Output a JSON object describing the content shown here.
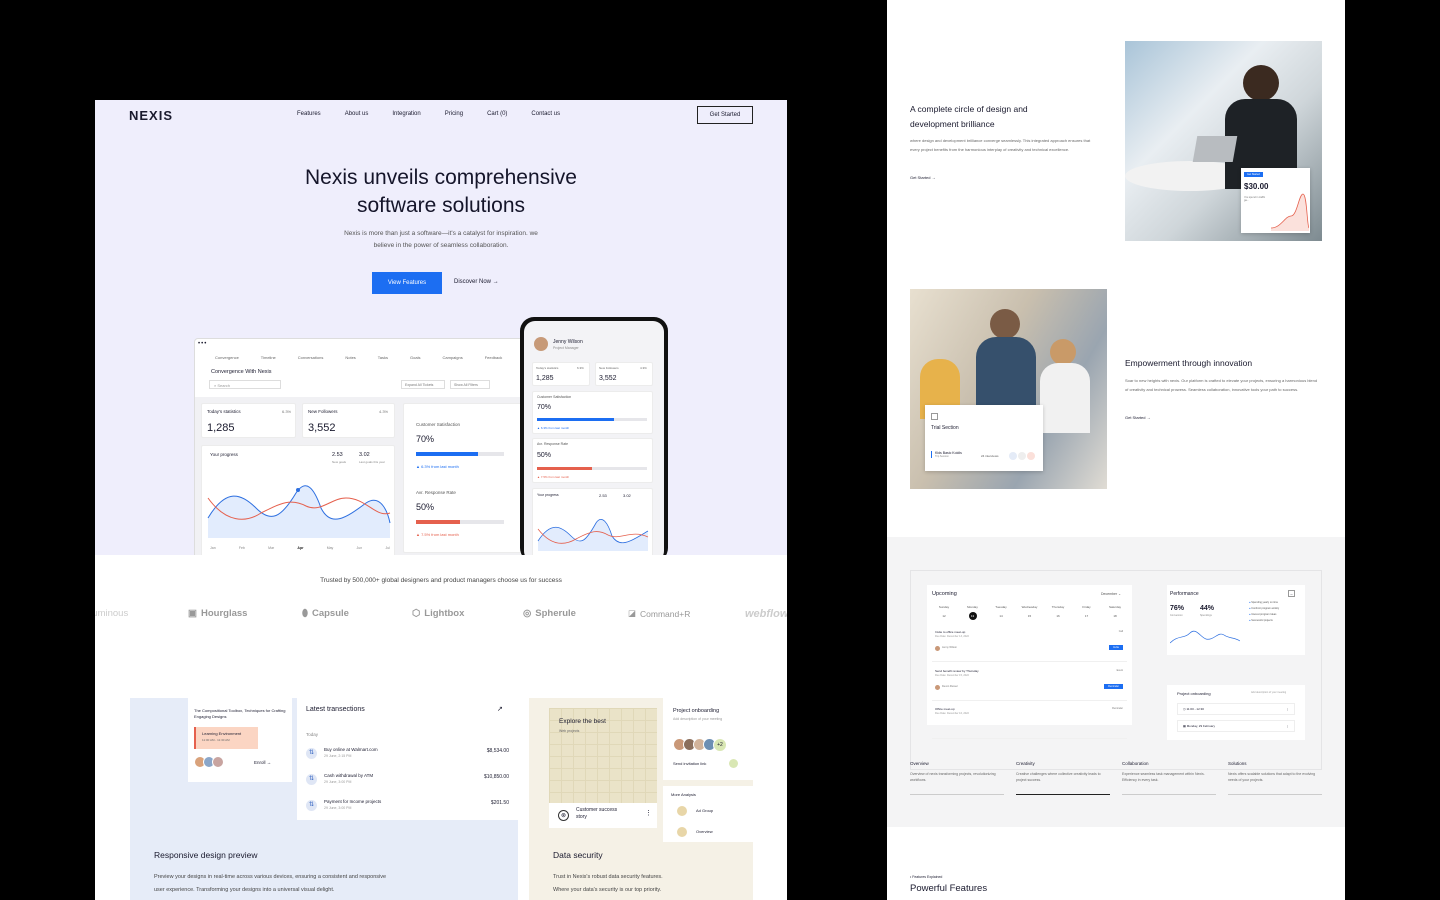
{
  "nav": {
    "logo": "NEXIS",
    "links": [
      "Features",
      "About us",
      "Integration",
      "Pricing",
      "Cart (0)",
      "Contact us"
    ],
    "cta": "Get Started"
  },
  "hero": {
    "title_line1": "Nexis unveils comprehensive",
    "title_line2": "software solutions",
    "subtitle_line1": "Nexis is more than just a software—it's a catalyst for inspiration. we",
    "subtitle_line2": "believe in the power of seamless collaboration.",
    "primary_btn": "View Features",
    "secondary_btn": "Discover Now"
  },
  "dashboard": {
    "tabs": [
      "Convergence",
      "Timeline",
      "Conversations",
      "Notes",
      "Tasks",
      "Goals",
      "Campaigns",
      "Feedback"
    ],
    "title": "Convergence With Nexis",
    "search_placeholder": "Search",
    "expand_btn": "Expand All Tickets",
    "show_btn": "Show All Filters",
    "stats": [
      {
        "label": "Today's statistics",
        "change": "6.3%",
        "value": "1,285"
      },
      {
        "label": "New Followers",
        "change": "4.3%",
        "value": "3,552"
      }
    ],
    "progress": {
      "label": "Your progress",
      "v1": "2.53",
      "v1_label": "New goals",
      "v2": "3.02",
      "v2_label": "Last goals this year"
    },
    "months": [
      "Jan",
      "Feb",
      "Mar",
      "Apr",
      "May",
      "Jun",
      "Jul"
    ],
    "satisfaction": {
      "label": "Customer Satisfaction",
      "value": "70%",
      "note": "6.3% from last month",
      "fill": 0.7
    },
    "response": {
      "label": "Avr. Response Rate",
      "value": "50%",
      "note": "7.5% from last month",
      "fill": 0.5
    }
  },
  "phone": {
    "name": "Jenny Wilson",
    "role": "Project Manager",
    "stat1_label": "Today's statistics",
    "stat1_change": "6.3%",
    "stat1": "1,285",
    "stat2_label": "New Followers",
    "stat2_change": "4.3%",
    "stat2": "3,552",
    "sat_label": "Customer Satisfaction",
    "sat": "70%",
    "sat_note": "6.3% from last month",
    "resp_label": "Avr. Response Rate",
    "resp": "50%",
    "resp_note": "7.5% from last month",
    "prog_label": "Your progress",
    "prog_v1": "2.53",
    "prog_v2": "3.02"
  },
  "trusted": "Trusted by 500,000+ global designers and product managers choose us for success",
  "brands": [
    "Luminous",
    "Hourglass",
    "Capsule",
    "Lightbox",
    "Spherule",
    "Command+R",
    "webflow"
  ],
  "feature_responsive": {
    "card_title": "The Compositional Toolbox, Techniques for Crafting Engaging Designs",
    "env": "Learning Environment",
    "env_time": "11:00 AM - 11:30 AM",
    "enroll": "Enroll",
    "tx_title": "Latest transections",
    "tx_day": "Today",
    "transactions": [
      {
        "name": "Buy online at Walmart.com",
        "date": "29 June, 2:15 PM",
        "amount": "$8,534.00"
      },
      {
        "name": "Cash withdrawal by ATM",
        "date": "29 June, 3:00 PM",
        "amount": "$10,850.00"
      },
      {
        "name": "Payment for Income projects",
        "date": "29 June, 3:00 PM",
        "amount": "$201.50"
      }
    ],
    "heading": "Responsive design preview",
    "desc_line1": "Preview your designs in real-time across various devices, ensuring a consistent and responsive",
    "desc_line2": "user experience. Transforming your designs into a universal visual delight."
  },
  "feature_security": {
    "explore": "Explore the best",
    "explore_sub": "Web projects",
    "story": "Customer success story",
    "onboard": "Project onboarding",
    "onboard_sub": "Add description of your meeting",
    "more_count": "+2",
    "invite": "Send invitation link",
    "more": "More Analysis",
    "add_group": "Ad Group",
    "overview": "Overview",
    "heading": "Data security",
    "desc_line1": "Trust in Nexis's robust data security features.",
    "desc_line2": "Where your data's security is our top priority."
  },
  "right_top": {
    "heading_line1": "A complete circle of design and",
    "heading_line2": "development brilliance",
    "desc": "where design and development brilliance converge seamlessly. This integrated approach ensures that every project benefits from the harmonious interplay of creativity and technical excellence.",
    "link": "Get Started",
    "price_tag": "Get Started",
    "price": "$30.00",
    "price_note": "You spend in traffic ga..."
  },
  "right_mid": {
    "heading": "Empowerment through innovation",
    "desc": "Soar to new heights with nexis. Our platform is crafted to elevate your projects, ensuring a harmonious blend of creativity and technical prowess. Seamless collaboration, innovative tools your path to success.",
    "link": "Get Started",
    "trial": "Trial Section",
    "trial_item": "Kids Basic Koidis",
    "trial_item_sub": "Trip Session",
    "trial_interviews": "24 interviews"
  },
  "right_dash": {
    "upcoming": "Upcoming",
    "month": "December",
    "days": [
      "Sunday",
      "Monday",
      "Tuesday",
      "Wednesday",
      "Thursday",
      "Friday",
      "Saturday"
    ],
    "dates": [
      "12",
      "13",
      "14",
      "15",
      "16",
      "17",
      "18"
    ],
    "events": [
      {
        "title": "Invite to office meet-up",
        "date": "Due Date: December 13, 2022",
        "tag": "Call",
        "person": "Jenny Wilson",
        "action": "Invite"
      },
      {
        "title": "Send benefit review by Thursday",
        "date": "Due Date: December 15, 2022",
        "tag": "Event",
        "person": "Devon Russel",
        "action": "Reminder"
      },
      {
        "title": "Office meet-up",
        "date": "Due Date: December 16, 2022",
        "tag": "Reminder",
        "person": "",
        "action": ""
      }
    ],
    "performance": "Performance",
    "perf1": "76%",
    "perf1_label": "Conversion",
    "perf2": "44%",
    "perf2_label": "Spendings",
    "perf_legend": [
      "Spending yearly on time",
      "Confront program activity",
      "Interest program Ideas",
      "Successful projects"
    ],
    "onboard": "Project onboarding",
    "onboard_sub": "Add description of your meeting",
    "time": "11:00 - 12:30",
    "date": "Monday, 29 February"
  },
  "tabs": [
    {
      "title": "Overview",
      "desc": "Overview of nexis transforming projects, revolutionizing workflows."
    },
    {
      "title": "Creativity",
      "desc": "Creative challenges where collective creativity leads to project success."
    },
    {
      "title": "Collaboration",
      "desc": "Experience seamless task management within Nexis. Efficiency in every task."
    },
    {
      "title": "Solutions",
      "desc": "Nexis offers scalable solutions that adapt to the evolving needs of your projects."
    }
  ],
  "bottom": {
    "eyebrow": "Features Explained",
    "heading": "Powerful Features"
  },
  "colors": {
    "accent": "#1c6ef2",
    "hero_bg": "#efeefc",
    "danger": "#e5604d"
  }
}
